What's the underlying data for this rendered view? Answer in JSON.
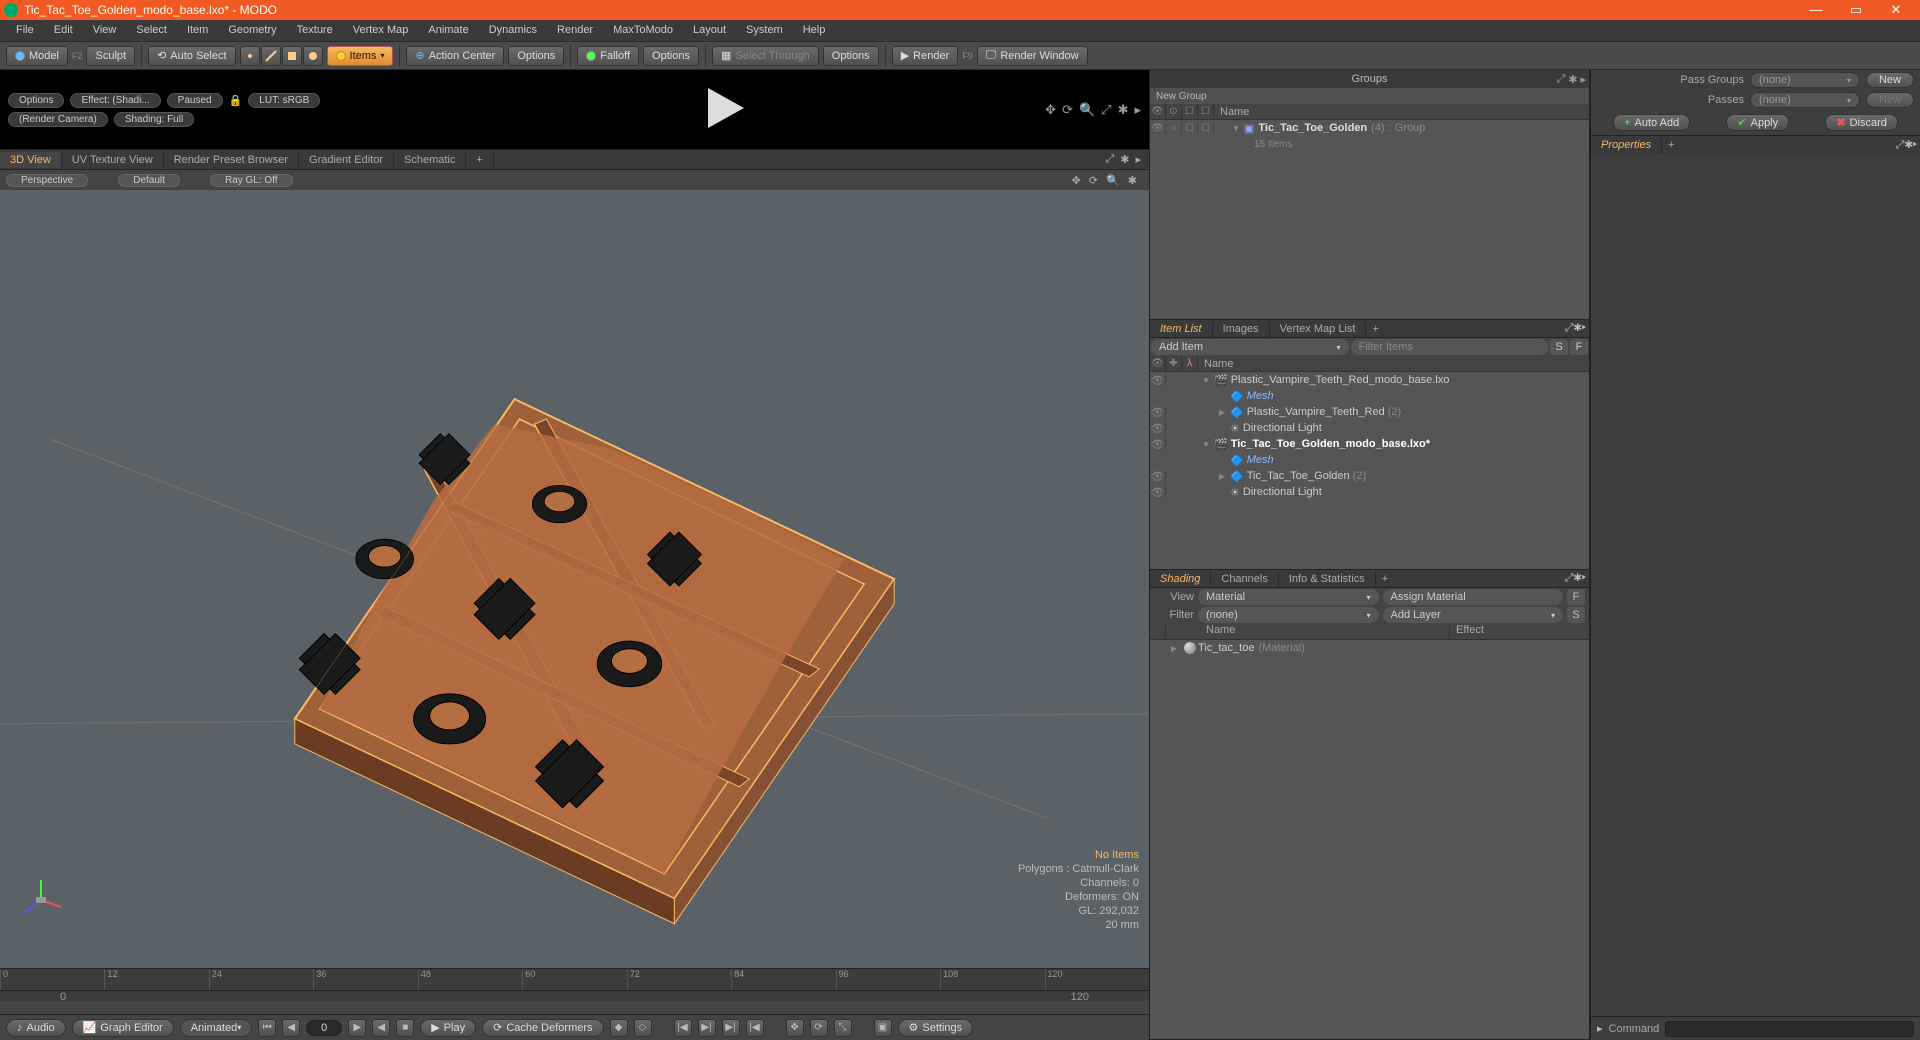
{
  "window": {
    "title": "Tic_Tac_Toe_Golden_modo_base.lxo* - MODO"
  },
  "menu": [
    "File",
    "Edit",
    "View",
    "Select",
    "Item",
    "Geometry",
    "Texture",
    "Vertex Map",
    "Animate",
    "Dynamics",
    "Render",
    "MaxToModo",
    "Layout",
    "System",
    "Help"
  ],
  "toolbar": {
    "model": "Model",
    "model_key": "F2",
    "sculpt": "Sculpt",
    "autoselect": "Auto Select",
    "items": "Items",
    "action_center": "Action Center",
    "options1": "Options",
    "falloff": "Falloff",
    "options2": "Options",
    "select_through": "Select Through",
    "options3": "Options",
    "render": "Render",
    "render_key": "F9",
    "render_window": "Render Window"
  },
  "preview": {
    "options": "Options",
    "effect": "Effect: (Shadi...",
    "paused": "Paused",
    "lut": "LUT: sRGB",
    "camera": "(Render Camera)",
    "shading": "Shading: Full"
  },
  "viewtabs": [
    "3D View",
    "UV Texture View",
    "Render Preset Browser",
    "Gradient Editor",
    "Schematic"
  ],
  "viewsub": {
    "perspective": "Perspective",
    "default": "Default",
    "raygl": "Ray GL: Off"
  },
  "viewport_info": {
    "noitems": "No Items",
    "polys": "Polygons : Catmull-Clark",
    "channels": "Channels: 0",
    "deformers": "Deformers: ON",
    "gl": "GL: 292,032",
    "mm": "20 mm"
  },
  "timeline": {
    "ticks": [
      "0",
      "12",
      "24",
      "36",
      "48",
      "60",
      "72",
      "84",
      "96",
      "108",
      "120"
    ],
    "sub": [
      "0",
      "120"
    ]
  },
  "bottombar": {
    "audio": "Audio",
    "graph": "Graph Editor",
    "animated": "Animated",
    "frame": "0",
    "play": "Play",
    "cache": "Cache Deformers",
    "settings": "Settings"
  },
  "groups": {
    "title": "Groups",
    "new": "New Group",
    "name_col": "Name",
    "row": {
      "name": "Tic_Tac_Toe_Golden",
      "count": "(4)",
      "type": ": Group",
      "items": "15 Items"
    }
  },
  "itemlist": {
    "tabs": [
      "Item List",
      "Images",
      "Vertex Map List"
    ],
    "add": "Add Item",
    "filter": "Filter Items",
    "name_col": "Name",
    "rows": [
      {
        "indent": 0,
        "tri": "▼",
        "ico": "🎬",
        "nm": "Plastic_Vampire_Teeth_Red_modo_base.lxo",
        "bold": false,
        "vis": "👁"
      },
      {
        "indent": 1,
        "tri": "",
        "ico": "🔷",
        "nm": "Mesh",
        "mesh": true,
        "vis": ""
      },
      {
        "indent": 1,
        "tri": "▶",
        "ico": "🔷",
        "nm": "Plastic_Vampire_Teeth_Red",
        "cnt": "(2)",
        "vis": "👁"
      },
      {
        "indent": 1,
        "tri": "",
        "ico": "☀",
        "nm": "Directional Light",
        "vis": "👁"
      },
      {
        "indent": 0,
        "tri": "▼",
        "ico": "🎬",
        "nm": "Tic_Tac_Toe_Golden_modo_base.lxo*",
        "bold": true,
        "vis": "👁"
      },
      {
        "indent": 1,
        "tri": "",
        "ico": "🔷",
        "nm": "Mesh",
        "mesh": true,
        "vis": ""
      },
      {
        "indent": 1,
        "tri": "▶",
        "ico": "🔷",
        "nm": "Tic_Tac_Toe_Golden",
        "cnt": "(2)",
        "vis": "👁"
      },
      {
        "indent": 1,
        "tri": "",
        "ico": "☀",
        "nm": "Directional Light",
        "vis": "👁"
      }
    ]
  },
  "shading": {
    "tabs": [
      "Shading",
      "Channels",
      "Info & Statistics"
    ],
    "view_lbl": "View",
    "view": "Material",
    "assign": "Assign Material",
    "filter_lbl": "Filter",
    "filter": "(none)",
    "addlayer": "Add Layer",
    "name_col": "Name",
    "effect_col": "Effect",
    "item": {
      "name": "Tic_tac_toe",
      "mat": "(Material)"
    }
  },
  "farright": {
    "passgroups_lbl": "Pass Groups",
    "passgroups": "(none)",
    "new": "New",
    "passes_lbl": "Passes",
    "passes": "(none)",
    "new2": "New",
    "autoadd": "Auto Add",
    "apply": "Apply",
    "discard": "Discard",
    "properties": "Properties",
    "command": "Command"
  }
}
